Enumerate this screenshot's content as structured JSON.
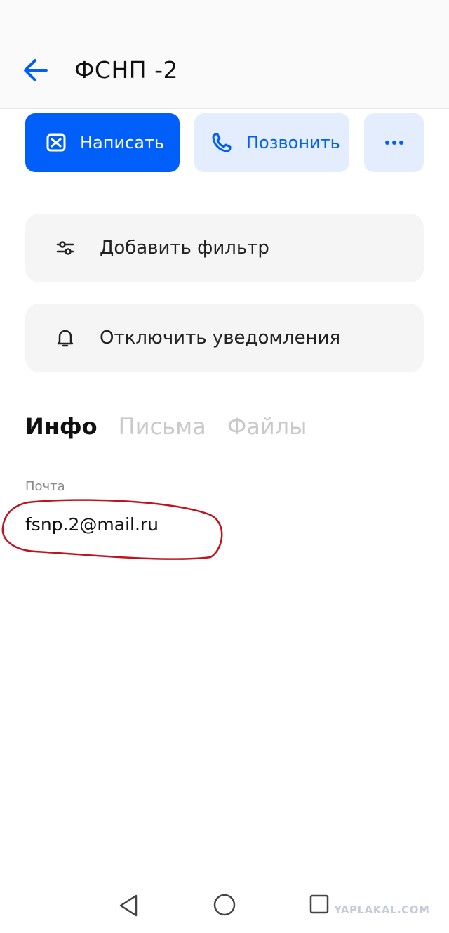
{
  "header": {
    "title": "ФСНП -2",
    "back_icon": "arrow-left-icon"
  },
  "actions": {
    "write_label": "Написать",
    "write_icon": "mail-icon",
    "call_label": "Позвонить",
    "call_icon": "phone-icon",
    "more_icon": "more-icon"
  },
  "options": [
    {
      "label": "Добавить фильтр",
      "icon": "filter-icon"
    },
    {
      "label": "Отключить уведомления",
      "icon": "bell-icon"
    }
  ],
  "tabs": [
    {
      "label": "Инфо",
      "active": true
    },
    {
      "label": "Письма",
      "active": false
    },
    {
      "label": "Файлы",
      "active": false
    }
  ],
  "info": {
    "email_label": "Почта",
    "email_value": "fsnp.2@mail.ru"
  },
  "watermark": "YAPLAKAL.COM",
  "colors": {
    "accent": "#005ff9",
    "accent_light": "#e4edfd",
    "highlight_circle": "#c1121f"
  }
}
